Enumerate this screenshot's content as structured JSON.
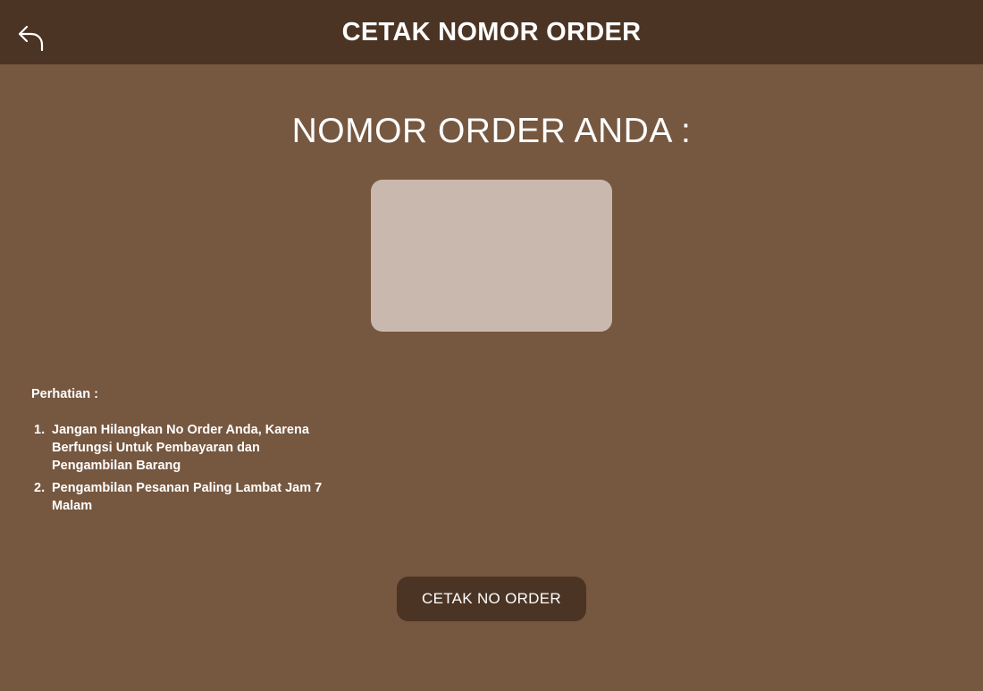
{
  "header": {
    "title": "CETAK NOMOR ORDER",
    "back_icon": "back-arrow-icon"
  },
  "main": {
    "heading": "NOMOR ORDER ANDA :",
    "order_number": ""
  },
  "notice": {
    "title": "Perhatian :",
    "items": [
      {
        "number": "1.",
        "text": "Jangan Hilangkan No Order Anda, Karena Berfungsi Untuk Pembayaran dan Pengambilan Barang"
      },
      {
        "number": "2.",
        "text": "Pengambilan Pesanan Paling Lambat Jam 7 Malam"
      }
    ]
  },
  "actions": {
    "print_label": "CETAK NO ORDER"
  },
  "colors": {
    "background": "#765740",
    "header": "#4b3424",
    "order_box": "#c9b8ae",
    "button": "#4b3424",
    "text": "#ffffff"
  }
}
